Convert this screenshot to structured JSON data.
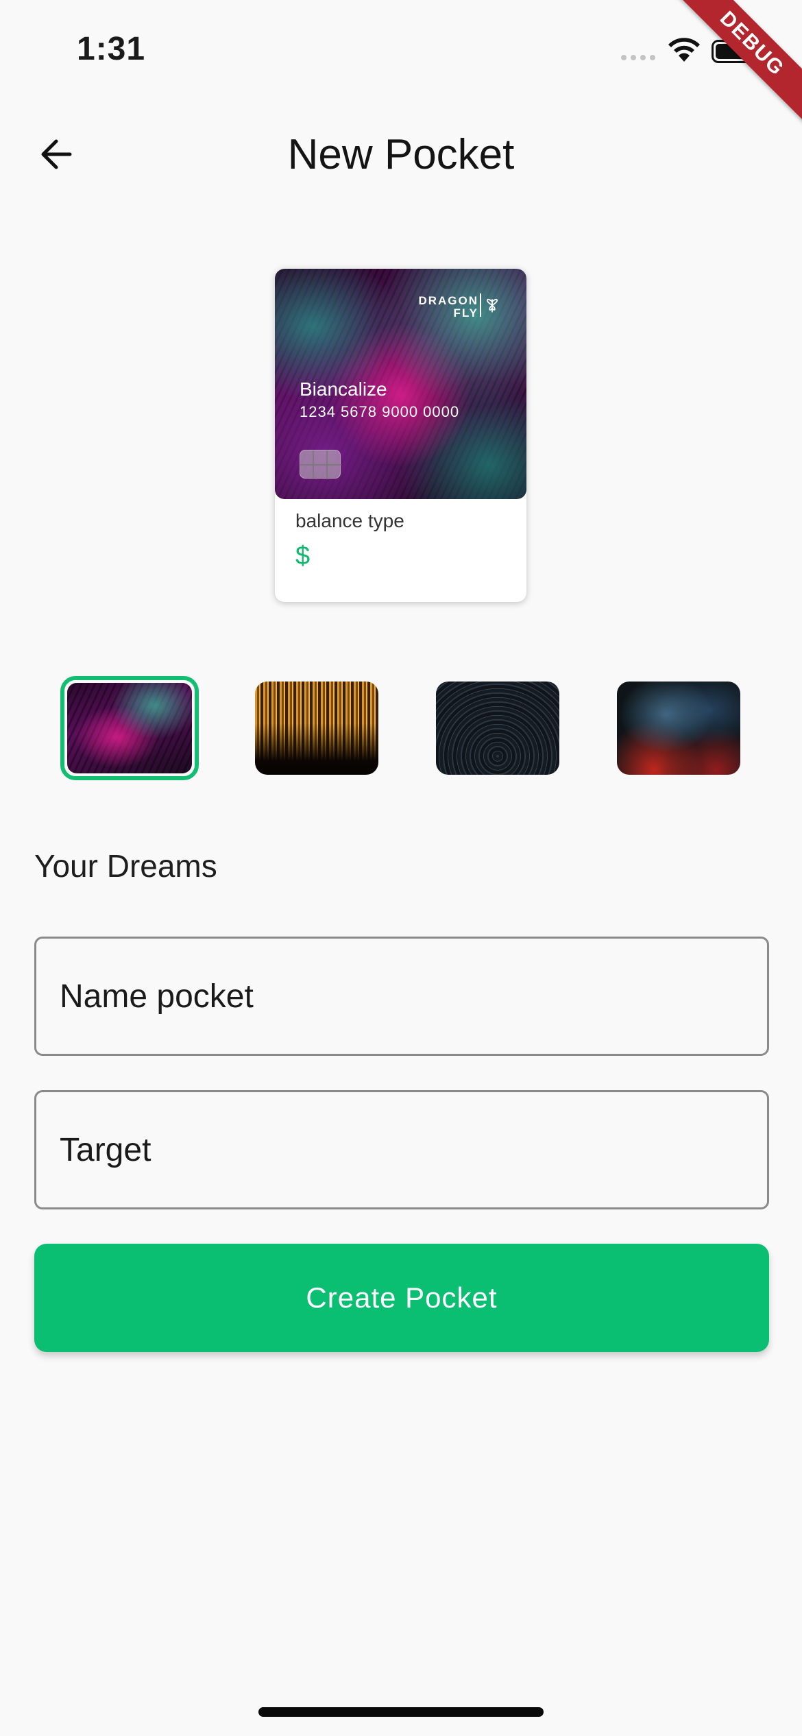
{
  "status_bar": {
    "time": "1:31"
  },
  "debug_banner": {
    "label": "DEBUG"
  },
  "app_bar": {
    "title": "New Pocket"
  },
  "preview_card": {
    "brand_line1": "DRAGON",
    "brand_line2": "FLY",
    "holder_name": "Biancalize",
    "card_number": "1234 5678 9000 0000",
    "balance_label": "balance type",
    "currency_symbol": "$"
  },
  "card_designs": {
    "selected_index": 0,
    "items": [
      "purple-teal-fur",
      "golden-streaks",
      "dark-star-trails",
      "blue-red-smoke"
    ]
  },
  "form": {
    "section_title": "Your Dreams",
    "name_placeholder": "Name pocket",
    "target_placeholder": "Target",
    "submit_label": "Create Pocket"
  },
  "colors": {
    "accent": "#0bbf72",
    "currency": "#12b86f",
    "background": "#f9f9f9",
    "debug_banner": "#b3262e"
  }
}
